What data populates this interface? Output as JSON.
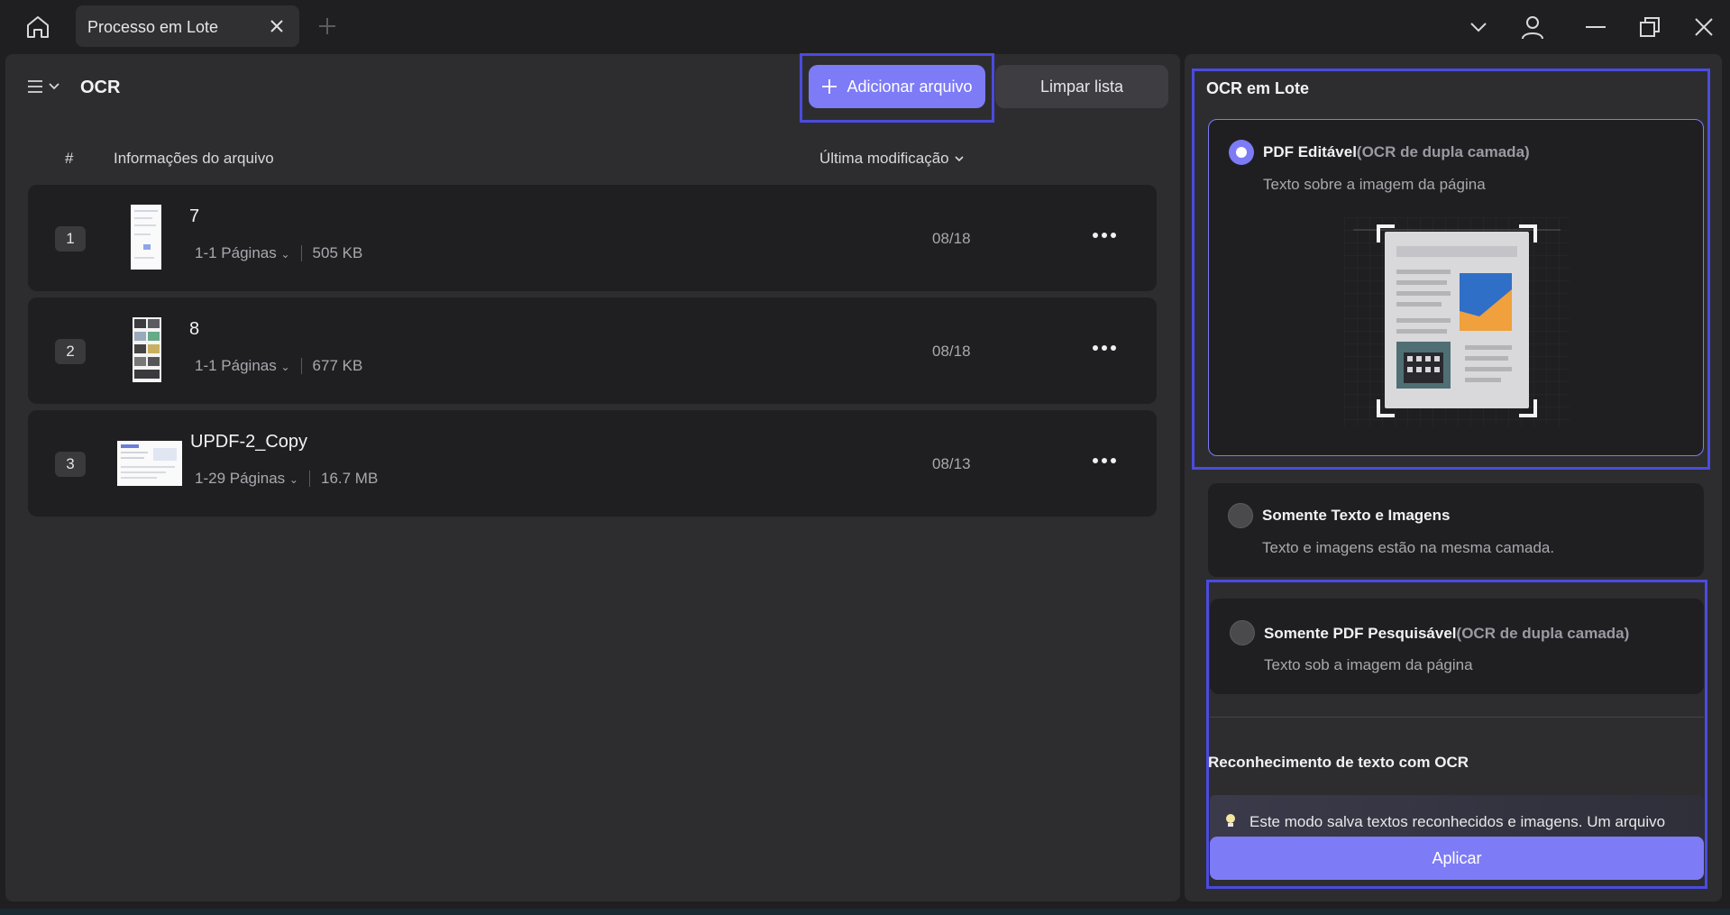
{
  "tab": {
    "label": "Processo em Lote"
  },
  "toolbar": {
    "title": "OCR",
    "add_label": "Adicionar arquivo",
    "clear_label": "Limpar lista"
  },
  "columns": {
    "hash": "#",
    "info": "Informações do arquivo",
    "modified": "Última modificação"
  },
  "files": [
    {
      "num": "1",
      "name": "7",
      "pages": "1-1 Páginas",
      "size": "505 KB",
      "date": "08/18"
    },
    {
      "num": "2",
      "name": "8",
      "pages": "1-1 Páginas",
      "size": "677 KB",
      "date": "08/18"
    },
    {
      "num": "3",
      "name": "UPDF-2_Copy",
      "pages": "1-29 Páginas",
      "size": "16.7 MB",
      "date": "08/13"
    }
  ],
  "panel": {
    "title": "OCR em Lote",
    "options": [
      {
        "title": "PDF Editável",
        "tag": "(OCR de dupla camada)",
        "desc": "Texto sobre a imagem da página",
        "selected": true
      },
      {
        "title": "Somente Texto e Imagens",
        "tag": "",
        "desc": "Texto e imagens estão na mesma camada.",
        "selected": false
      },
      {
        "title": "Somente PDF Pesquisável",
        "tag": "(OCR de dupla camada)",
        "desc": "Texto sob a imagem da página",
        "selected": false
      }
    ],
    "ocr_title": "Reconhecimento de texto com OCR",
    "tip": "Este modo salva textos reconhecidos e imagens. Um arquivo",
    "apply_label": "Aplicar"
  },
  "colors": {
    "accent": "#7d7bf6",
    "highlight_frame": "#4b4be0",
    "background": "#1f1f21",
    "panel": "#2d2d30"
  }
}
